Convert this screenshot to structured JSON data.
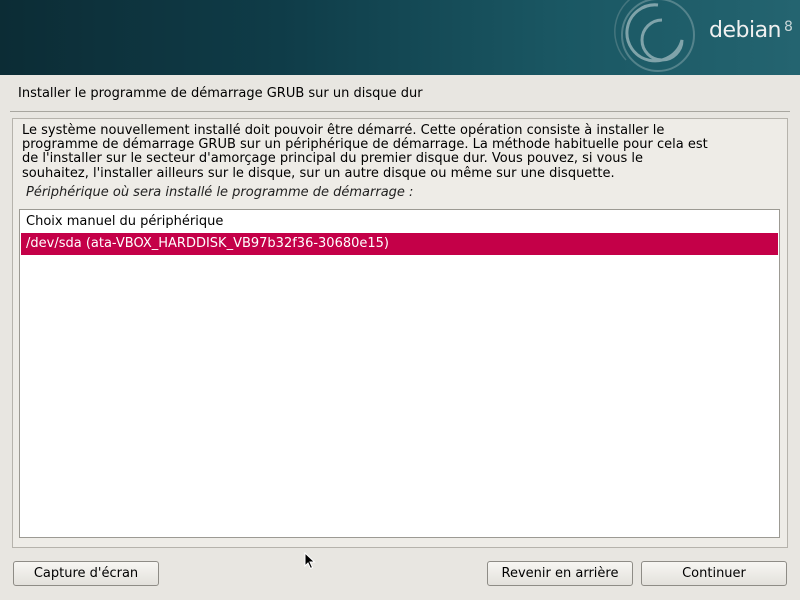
{
  "banner": {
    "logo_text": "debian",
    "logo_version": "8"
  },
  "page": {
    "title": "Installer le programme de démarrage GRUB sur un disque dur"
  },
  "description": {
    "lines": [
      "Le système nouvellement installé doit pouvoir être démarré. Cette opération consiste à installer le",
      "programme de démarrage GRUB sur un périphérique de démarrage. La méthode habituelle pour cela est",
      "de l'installer sur le secteur d'amorçage principal du premier disque dur. Vous pouvez, si vous le",
      "souhaitez, l'installer ailleurs sur le disque, sur un autre disque ou même sur une disquette."
    ],
    "prompt": "Périphérique où sera installé le programme de démarrage :"
  },
  "device_list": {
    "items": [
      {
        "label": "Choix manuel du périphérique",
        "selected": false
      },
      {
        "label": "/dev/sda  (ata-VBOX_HARDDISK_VB97b32f36-30680e15)",
        "selected": true
      }
    ]
  },
  "buttons": {
    "screenshot": "Capture d'écran",
    "back": "Revenir en arrière",
    "continue": "Continuer"
  },
  "colors": {
    "selection": "#c40048",
    "banner": "#0f3c48"
  },
  "icons": {
    "banner_swirl": "debian-swirl-icon",
    "cursor": "mouse-pointer-icon"
  }
}
